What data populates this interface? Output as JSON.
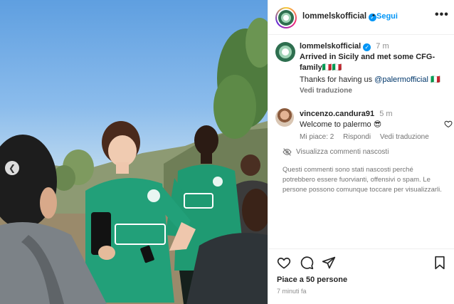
{
  "post": {
    "username": "lommelskofficial",
    "follow_label": "Segui",
    "separator": "•",
    "more_label": "•••"
  },
  "caption": {
    "username": "lommelskofficial",
    "time": "7 m",
    "text_line1": "Arrived in Sicily and met some CFG-",
    "text_line2": "family🇮🇹🇮🇹",
    "thanks_text": "Thanks for having us ",
    "mention": "@palermofficial",
    "flag": "🇮🇹",
    "translate_label": "Vedi traduzione"
  },
  "comment": {
    "username": "vincenzo.candura91",
    "time": "5 m",
    "text": "Welcome to palermo 😎",
    "likes_label": "Mi piace: 2",
    "reply_label": "Rispondi",
    "translate_label": "Vedi traduzione"
  },
  "hidden": {
    "toggle_label": "Visualizza commenti nascosti",
    "note": "Questi commenti sono stati nascosti perché potrebbero essere fuorvianti, offensivi o spam. Le persone possono comunque toccare per visualizzarli."
  },
  "footer": {
    "likes": "Piace a 50 persone",
    "posted_ago": "7 minuti fa"
  },
  "icons": {
    "verified": "verified-badge-icon",
    "heart": "heart-icon",
    "comment": "comment-icon",
    "share": "share-icon",
    "save": "bookmark-icon",
    "carousel_prev": "chevron-left-icon",
    "eye_off": "eye-slash-icon"
  },
  "colors": {
    "accent": "#0095f6",
    "jersey": "#1f9a72",
    "muted": "#737373"
  }
}
